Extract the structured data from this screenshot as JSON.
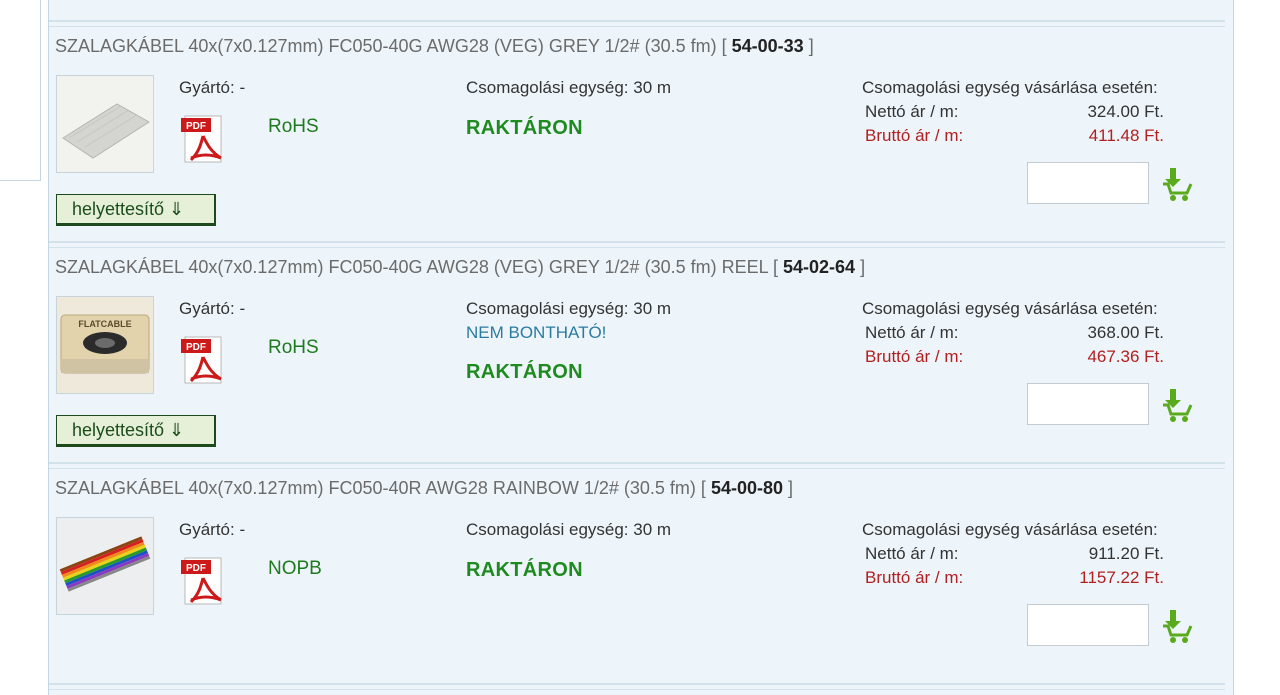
{
  "labels": {
    "manufacturer": "Gyártó: -",
    "packaging": "Csomagolási egység: 30 m",
    "buy_heading": "Csomagolási egység vásárlása esetén:",
    "net_label": "Nettó ár / m:",
    "gross_label": "Bruttó ár / m:",
    "substitute_button": "helyettesítő ⇓",
    "in_stock": "RAKTÁRON",
    "pdf_badge": "PDF"
  },
  "products": [
    {
      "name": "SZALAGKÁBEL 40x(7x0.127mm) FC050-40G AWG28 (VEG) GREY 1/2# (30.5 fm)",
      "bracket_open": "[",
      "code": "54-00-33",
      "bracket_close": "]",
      "compliance": "RoHS",
      "note": "",
      "net_price": "324.00 Ft.",
      "gross_price": "411.48 Ft.",
      "quantity": "",
      "image_icon": "grey-flat-cable-image"
    },
    {
      "name": "SZALAGKÁBEL 40x(7x0.127mm) FC050-40G AWG28 (VEG) GREY 1/2# (30.5 fm) REEL",
      "bracket_open": "[",
      "code": "54-02-64",
      "bracket_close": "]",
      "compliance": "RoHS",
      "note": "NEM BONTHATÓ!",
      "net_price": "368.00 Ft.",
      "gross_price": "467.36 Ft.",
      "quantity": "",
      "image_icon": "cable-reel-image",
      "reel_label": "FLATCABLE"
    },
    {
      "name": "SZALAGKÁBEL 40x(7x0.127mm) FC050-40R AWG28 RAINBOW 1/2# (30.5 fm)",
      "bracket_open": "[",
      "code": "54-00-80",
      "bracket_close": "]",
      "compliance": "NOPB",
      "note": "",
      "net_price": "911.20 Ft.",
      "gross_price": "1157.22 Ft.",
      "quantity": "",
      "image_icon": "rainbow-flat-cable-image"
    }
  ],
  "colors": {
    "panel_bg": "#eef5fa",
    "stock_green": "#1f8a1f",
    "gross_red": "#b02020",
    "note_blue": "#2a7ba0",
    "cart_green": "#5aaa1e",
    "pdf_red": "#cc1a1a"
  },
  "icons": [
    "pdf-icon",
    "add-to-cart-icon"
  ]
}
